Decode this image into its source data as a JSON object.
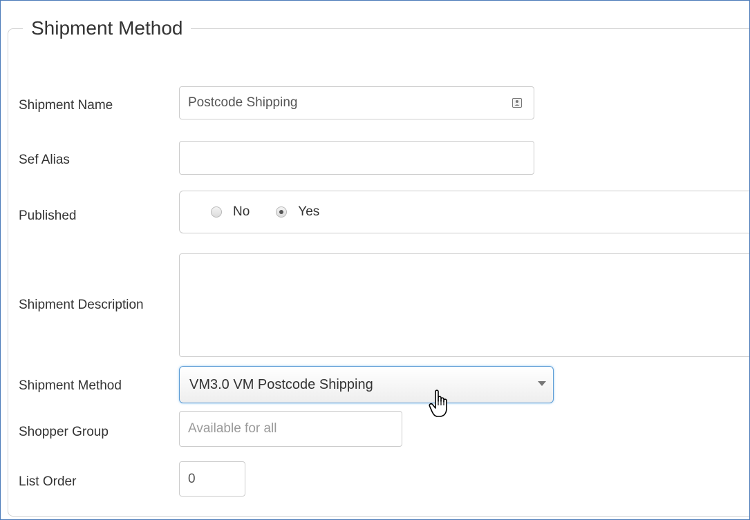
{
  "fieldset": {
    "legend": "Shipment Method"
  },
  "fields": {
    "shipment_name": {
      "label": "Shipment Name",
      "value": "Postcode Shipping",
      "icon": "contact-card-icon"
    },
    "sef_alias": {
      "label": "Sef Alias",
      "value": ""
    },
    "published": {
      "label": "Published",
      "options": [
        "No",
        "Yes"
      ],
      "selected": "Yes"
    },
    "shipment_description": {
      "label": "Shipment Description",
      "value": ""
    },
    "shipment_method": {
      "label": "Shipment Method",
      "selected": "VM3.0 VM Postcode Shipping",
      "icon": "chevron-down-icon"
    },
    "shopper_group": {
      "label": "Shopper Group",
      "placeholder": "Available for all"
    },
    "list_order": {
      "label": "List Order",
      "value": "0"
    }
  },
  "colors": {
    "frame_border": "#4a7ab8",
    "focus_border": "#5b9bd5",
    "text": "#333333",
    "placeholder": "#9a9a9a"
  },
  "cursor": {
    "icon": "hand-pointer-icon"
  }
}
